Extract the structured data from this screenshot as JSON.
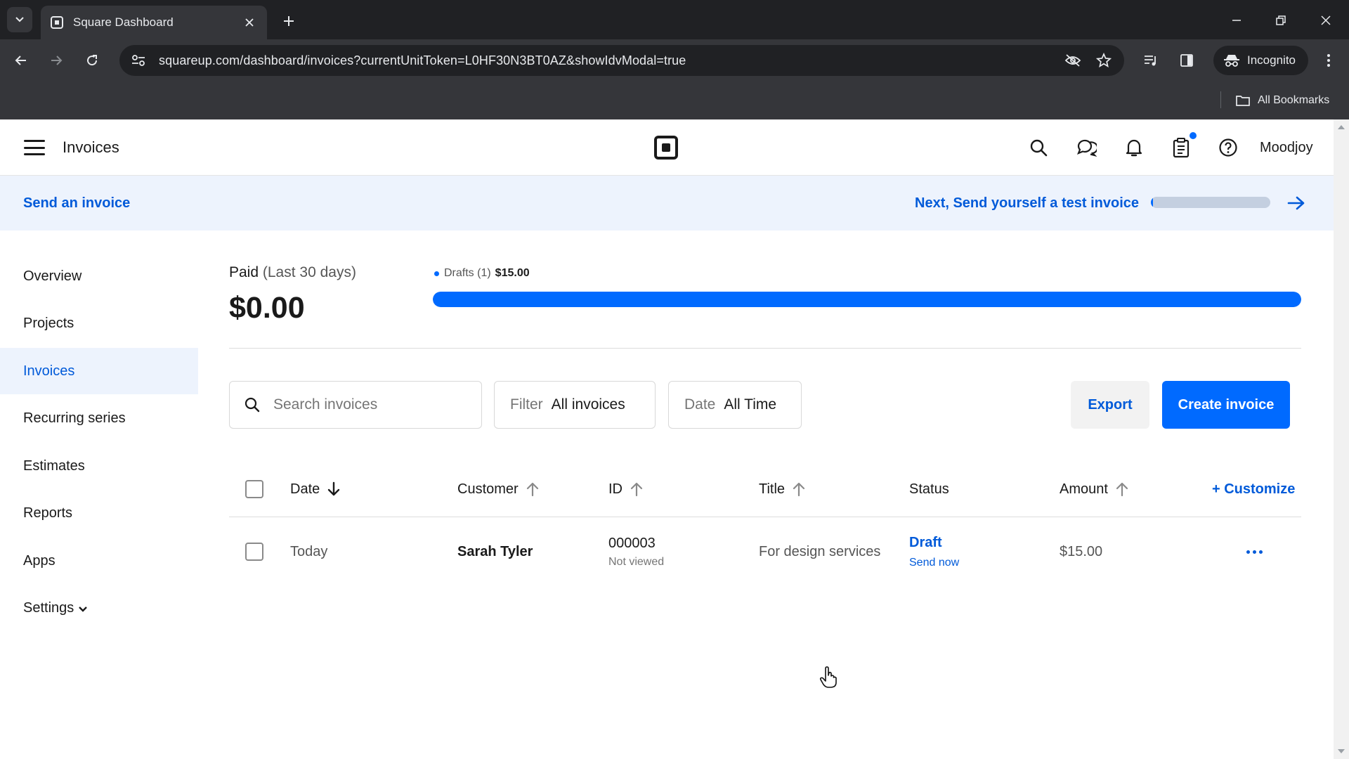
{
  "browser": {
    "tab_title": "Square Dashboard",
    "url": "squareup.com/dashboard/invoices?currentUnitToken=L0HF30N3BT0AZ&showIdvModal=true",
    "incognito_label": "Incognito",
    "bookmarks_label": "All Bookmarks"
  },
  "header": {
    "title": "Invoices",
    "user_name": "Moodjoy"
  },
  "banner": {
    "left_link": "Send an invoice",
    "right_link": "Next, Send yourself a test invoice",
    "progress_fraction": 0.02
  },
  "sidebar": {
    "items": [
      {
        "label": "Overview"
      },
      {
        "label": "Projects"
      },
      {
        "label": "Invoices"
      },
      {
        "label": "Recurring series"
      },
      {
        "label": "Estimates"
      },
      {
        "label": "Reports"
      },
      {
        "label": "Apps"
      },
      {
        "label": "Settings"
      }
    ]
  },
  "summary": {
    "paid_label": "Paid",
    "paid_period": "(Last 30 days)",
    "paid_amount": "$0.00",
    "drafts_label": "Drafts (1)",
    "drafts_amount": "$15.00",
    "drafts_fraction": 1.0
  },
  "toolbar": {
    "search_placeholder": "Search invoices",
    "filter_key": "Filter",
    "filter_value": "All invoices",
    "date_key": "Date",
    "date_value": "All Time",
    "export_label": "Export",
    "create_label": "Create invoice"
  },
  "table": {
    "columns": {
      "date": "Date",
      "customer": "Customer",
      "id": "ID",
      "title": "Title",
      "status": "Status",
      "amount": "Amount"
    },
    "customize_label": "+ Customize",
    "rows": [
      {
        "date": "Today",
        "customer": "Sarah Tyler",
        "id": "000003",
        "id_sub": "Not viewed",
        "title": "For design services",
        "status": "Draft",
        "status_action": "Send now",
        "amount": "$15.00"
      }
    ]
  },
  "colors": {
    "accent": "#006aff",
    "link": "#005ad9",
    "banner_bg": "#edf3fd"
  }
}
